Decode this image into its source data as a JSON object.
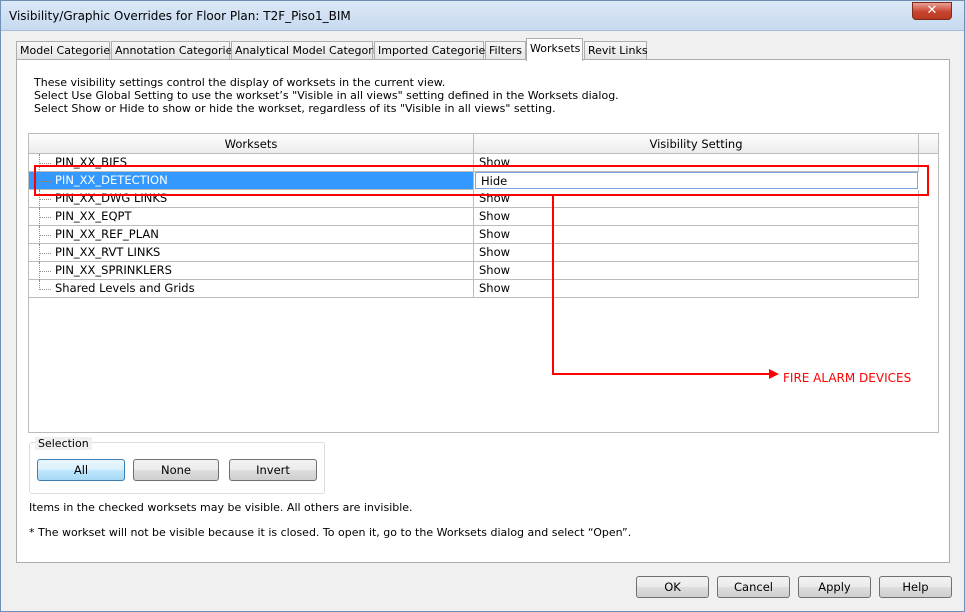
{
  "window": {
    "title": "Visibility/Graphic Overrides for Floor Plan: T2F_Piso1_BIM",
    "close_icon": "close-icon"
  },
  "tabs": [
    {
      "label": "Model Categories",
      "active": false
    },
    {
      "label": "Annotation Categories",
      "active": false
    },
    {
      "label": "Analytical Model Categories",
      "active": false
    },
    {
      "label": "Imported Categories",
      "active": false
    },
    {
      "label": "Filters",
      "active": false
    },
    {
      "label": "Worksets",
      "active": true
    },
    {
      "label": "Revit Links",
      "active": false
    }
  ],
  "description": [
    "These visibility settings control the display of worksets in the current view.",
    "Select Use Global Setting to use the workset’s \"Visible in all views\" setting defined in the Worksets dialog.",
    "Select Show or Hide to show or hide the workset, regardless of its \"Visible in all views\" setting."
  ],
  "grid": {
    "headers": [
      "Worksets",
      "Visibility Setting"
    ],
    "rows": [
      {
        "name": "PIN_XX_BIES",
        "visibility": "Show",
        "selected": false
      },
      {
        "name": "PIN_XX_DETECTION",
        "visibility": "Hide",
        "selected": true
      },
      {
        "name": "PIN_XX_DWG LINKS",
        "visibility": "Show",
        "selected": false
      },
      {
        "name": "PIN_XX_EQPT",
        "visibility": "Show",
        "selected": false
      },
      {
        "name": "PIN_XX_REF_PLAN",
        "visibility": "Show",
        "selected": false
      },
      {
        "name": "PIN_XX_RVT LINKS",
        "visibility": "Show",
        "selected": false
      },
      {
        "name": "PIN_XX_SPRINKLERS",
        "visibility": "Show",
        "selected": false
      },
      {
        "name": "Shared Levels and Grids",
        "visibility": "Show",
        "selected": false
      }
    ]
  },
  "selection": {
    "label": "Selection",
    "all": "All",
    "none": "None",
    "invert": "Invert"
  },
  "notes": {
    "checked": "Items in the checked worksets may be visible.  All others are invisible.",
    "closed": "* The workset will not be visible because it is closed. To open it, go to the Worksets dialog and select “Open”."
  },
  "buttons": {
    "ok": "OK",
    "cancel": "Cancel",
    "apply": "Apply",
    "help": "Help"
  },
  "annotation": {
    "text": "FIRE ALARM DEVICES",
    "color": "#ff0000"
  },
  "colors": {
    "selection": "#3399ff",
    "window_bg": "#f0f0f0"
  }
}
